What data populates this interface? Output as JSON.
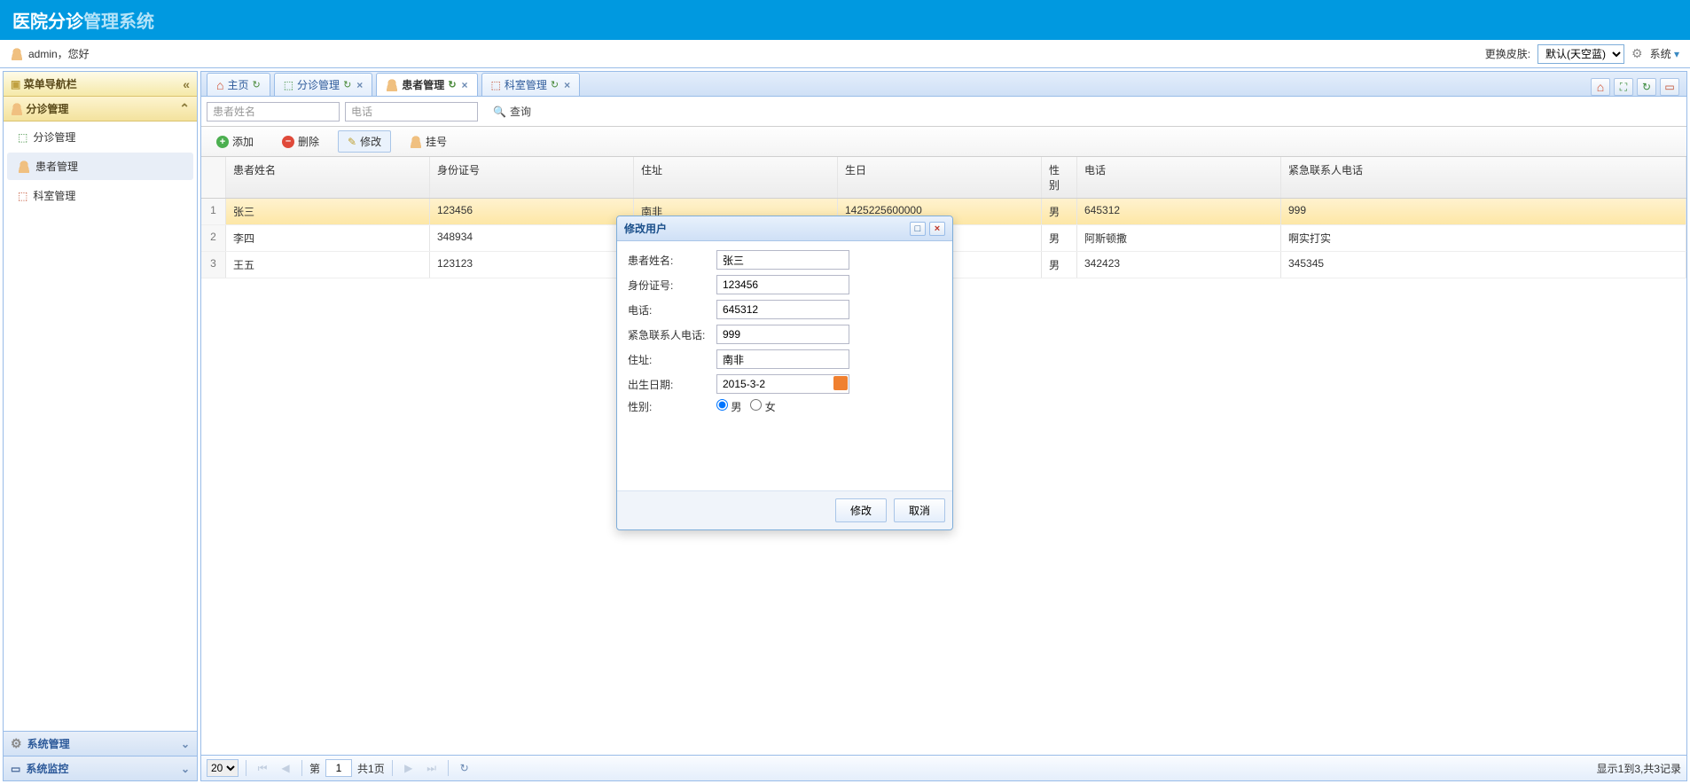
{
  "banner": {
    "part1": "医院分诊",
    "part2": "管理系统"
  },
  "userbar": {
    "greeting": "admin，您好",
    "skin_label": "更换皮肤:",
    "skin_value": "默认(天空蓝)",
    "system_label": "系统"
  },
  "sidebar": {
    "nav_title": "菜单导航栏",
    "group_title": "分诊管理",
    "items": [
      {
        "label": "分诊管理"
      },
      {
        "label": "患者管理"
      },
      {
        "label": "科室管理"
      }
    ],
    "accordion": [
      {
        "label": "系统管理"
      },
      {
        "label": "系统监控"
      }
    ]
  },
  "tabs": [
    {
      "label": "主页",
      "closable": false
    },
    {
      "label": "分诊管理",
      "closable": true
    },
    {
      "label": "患者管理",
      "closable": true,
      "active": true
    },
    {
      "label": "科室管理",
      "closable": true
    }
  ],
  "search": {
    "name_ph": "患者姓名",
    "tel_ph": "电话",
    "query_label": "查询"
  },
  "toolbar": {
    "add": "添加",
    "del": "删除",
    "edit": "修改",
    "register": "挂号"
  },
  "grid": {
    "headers": {
      "name": "患者姓名",
      "idcard": "身份证号",
      "addr": "住址",
      "birth": "生日",
      "sex": "性别",
      "tel": "电话",
      "em_tel": "紧急联系人电话"
    },
    "rows": [
      {
        "n": "1",
        "name": "张三",
        "idcard": "123456",
        "addr": "南非",
        "birth": "1425225600000",
        "sex": "男",
        "tel": "645312",
        "em": "999",
        "selected": true
      },
      {
        "n": "2",
        "name": "李四",
        "idcard": "348934",
        "addr": "",
        "birth": "",
        "sex": "男",
        "tel": "阿斯顿撒",
        "em": "啊实打实"
      },
      {
        "n": "3",
        "name": "王五",
        "idcard": "123123",
        "addr": "",
        "birth": "",
        "sex": "男",
        "tel": "342423",
        "em": "345345"
      }
    ]
  },
  "pager": {
    "page_size": "20",
    "page_label_prefix": "第",
    "page_value": "1",
    "total_pages": "共1页",
    "info": "显示1到3,共3记录"
  },
  "dialog": {
    "title": "修改用户",
    "fields": {
      "name_label": "患者姓名:",
      "name_value": "张三",
      "id_label": "身份证号:",
      "id_value": "123456",
      "tel_label": "电话:",
      "tel_value": "645312",
      "em_label": "紧急联系人电话:",
      "em_value": "999",
      "addr_label": "住址:",
      "addr_value": "南非",
      "birth_label": "出生日期:",
      "birth_value": "2015-3-2",
      "sex_label": "性别:",
      "sex_male": "男",
      "sex_female": "女"
    },
    "buttons": {
      "ok": "修改",
      "cancel": "取消"
    }
  }
}
